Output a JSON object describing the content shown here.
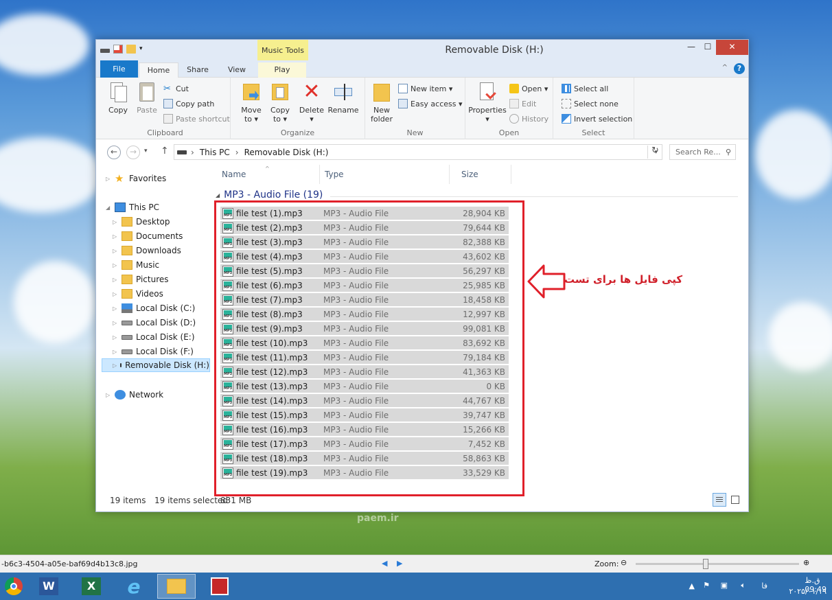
{
  "window": {
    "title": "Removable Disk (H:)",
    "contextual_tab": "Music Tools",
    "controls": {
      "minimize": "—",
      "maximize": "☐",
      "close": "✕"
    }
  },
  "ribbon_tabs": [
    "File",
    "Home",
    "Share",
    "View",
    "Play"
  ],
  "ribbon": {
    "clipboard": {
      "label": "Clipboard",
      "copy": "Copy",
      "paste": "Paste",
      "cut": "Cut",
      "copy_path": "Copy path",
      "paste_shortcut": "Paste shortcut"
    },
    "organize": {
      "label": "Organize",
      "move_to": "Move",
      "move_to_2": "to ▾",
      "copy_to": "Copy",
      "copy_to_2": "to ▾",
      "delete": "Delete",
      "delete_2": "▾",
      "rename": "Rename"
    },
    "new": {
      "label": "New",
      "new_folder": "New",
      "new_folder_2": "folder",
      "new_item": "New item ▾",
      "easy_access": "Easy access ▾"
    },
    "open": {
      "label": "Open",
      "properties": "Properties",
      "properties_2": "▾",
      "open": "Open ▾",
      "edit": "Edit",
      "history": "History"
    },
    "select": {
      "label": "Select",
      "select_all": "Select all",
      "select_none": "Select none",
      "invert": "Invert selection"
    }
  },
  "address": {
    "crumbs": [
      "This PC",
      "Removable Disk (H:)"
    ],
    "separator": "›",
    "search_placeholder": "Search Re..."
  },
  "nav": {
    "favorites": "Favorites",
    "this_pc": "This PC",
    "items": [
      "Desktop",
      "Documents",
      "Downloads",
      "Music",
      "Pictures",
      "Videos",
      "Local Disk (C:)",
      "Local Disk (D:)",
      "Local Disk (E:)",
      "Local Disk (F:)",
      "Removable Disk (H:)"
    ],
    "network": "Network"
  },
  "columns": {
    "name": "Name",
    "type": "Type",
    "size": "Size"
  },
  "group_header": "MP3 - Audio File (19)",
  "files": [
    {
      "name": "file test (1).mp3",
      "type": "MP3 - Audio File",
      "size": "28,904 KB"
    },
    {
      "name": "file test (2).mp3",
      "type": "MP3 - Audio File",
      "size": "79,644 KB"
    },
    {
      "name": "file test (3).mp3",
      "type": "MP3 - Audio File",
      "size": "82,388 KB"
    },
    {
      "name": "file test (4).mp3",
      "type": "MP3 - Audio File",
      "size": "43,602 KB"
    },
    {
      "name": "file test (5).mp3",
      "type": "MP3 - Audio File",
      "size": "56,297 KB"
    },
    {
      "name": "file test (6).mp3",
      "type": "MP3 - Audio File",
      "size": "25,985 KB"
    },
    {
      "name": "file test (7).mp3",
      "type": "MP3 - Audio File",
      "size": "18,458 KB"
    },
    {
      "name": "file test (8).mp3",
      "type": "MP3 - Audio File",
      "size": "12,997 KB"
    },
    {
      "name": "file test (9).mp3",
      "type": "MP3 - Audio File",
      "size": "99,081 KB"
    },
    {
      "name": "file test (10).mp3",
      "type": "MP3 - Audio File",
      "size": "83,692 KB"
    },
    {
      "name": "file test (11).mp3",
      "type": "MP3 - Audio File",
      "size": "79,184 KB"
    },
    {
      "name": "file test (12).mp3",
      "type": "MP3 - Audio File",
      "size": "41,363 KB"
    },
    {
      "name": "file test (13).mp3",
      "type": "MP3 - Audio File",
      "size": "0 KB"
    },
    {
      "name": "file test (14).mp3",
      "type": "MP3 - Audio File",
      "size": "44,767 KB"
    },
    {
      "name": "file test (15).mp3",
      "type": "MP3 - Audio File",
      "size": "39,747 KB"
    },
    {
      "name": "file test (16).mp3",
      "type": "MP3 - Audio File",
      "size": "15,266 KB"
    },
    {
      "name": "file test (17).mp3",
      "type": "MP3 - Audio File",
      "size": "7,452 KB"
    },
    {
      "name": "file test (18).mp3",
      "type": "MP3 - Audio File",
      "size": "58,863 KB"
    },
    {
      "name": "file test (19).mp3",
      "type": "MP3 - Audio File",
      "size": "33,529 KB"
    }
  ],
  "status": {
    "item_count": "19 items",
    "selected": "19 items selected",
    "selected_size": "831 MB"
  },
  "annotation": {
    "text": "کپی فایل ها برای تست",
    "color": "#e0202a"
  },
  "viewer": {
    "filename": "-b6c3-4504-a05e-baf69d4b13c8.jpg",
    "zoom_label": "Zoom:"
  },
  "watermark": "paem.ir",
  "tray": {
    "lang": "فا",
    "time": "ق.ظ 09:49",
    "date": "۲۰۲۵/۰۱/۱۹"
  },
  "colors": {
    "accent": "#1979ca",
    "selection": "#d9d9d9",
    "taskbar": "#2e6fb0"
  }
}
